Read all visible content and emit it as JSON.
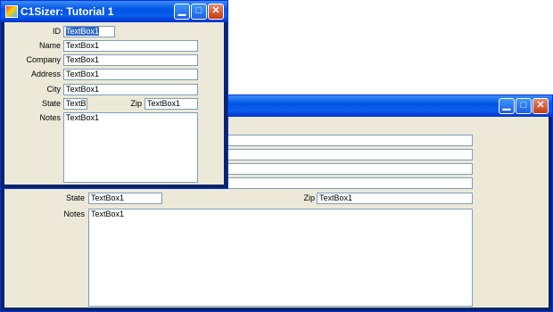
{
  "back_window": {
    "state_label": "State",
    "zip_label": "Zip",
    "notes_label": "Notes",
    "state_value": "TextBox1",
    "zip_value": "TextBox1",
    "notes_value": "TextBox1",
    "controls": {
      "minimize": "▁",
      "maximize": "□",
      "close": "✕"
    }
  },
  "front_window": {
    "title": "C1Sizer: Tutorial 1",
    "controls": {
      "minimize": "▁",
      "maximize": "□",
      "close": "✕"
    },
    "fields": {
      "id_label": "ID",
      "id_value": "TextBox1",
      "name_label": "Name",
      "name_value": "TextBox1",
      "company_label": "Company",
      "company_value": "TextBox1",
      "address_label": "Address",
      "address_value": "TextBox1",
      "city_label": "City",
      "city_value": "TextBox1",
      "state_label": "State",
      "state_value": "TextB",
      "zip_label": "Zip",
      "zip_value": "TextBox1",
      "notes_label": "Notes",
      "notes_value": "TextBox1"
    }
  }
}
